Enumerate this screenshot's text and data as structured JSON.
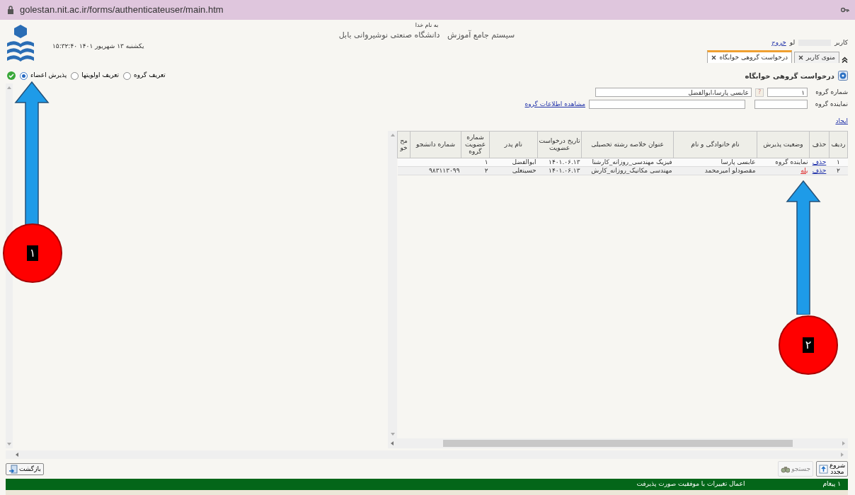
{
  "browser": {
    "url": "golestan.nit.ac.ir/forms/authenticateuser/main.htm"
  },
  "header": {
    "datetime": "۱۵:۳۲:۴۰ یکشنبه ۱۳ شهریور ۱۴۰۱",
    "blessing": "به نام خدا",
    "title": "سیستم جامع آموزش   دانشگاه صنعتی نوشیروانی بابل",
    "user_label": "کاربر",
    "user_name": "لو",
    "logout": "خروج"
  },
  "tabs": [
    {
      "label": "منوی کاربر",
      "selected": false
    },
    {
      "label": "درخواست گروهی خوابگاه",
      "selected": true
    }
  ],
  "modes": [
    {
      "label": "تعریف گروه",
      "selected": false
    },
    {
      "label": "تعریف اولویتها",
      "selected": false
    },
    {
      "label": "پذیرش اعضاء",
      "selected": true
    }
  ],
  "heading": "درخواست گروهی خوابگاه",
  "form": {
    "group_number_label": "شماره گروه",
    "group_number": "۱",
    "lookup_button": "?",
    "members": "عابسی  پارسا،ابوالفضل",
    "representative_label": "نماینده گروه",
    "view_group_link": "مشاهده اطلاعات گروه",
    "create_link": "ایجاد"
  },
  "table": {
    "columns": [
      "ردیف",
      "حذف",
      "وضعیت پذیرش",
      "نام خانوادگی و نام",
      "عنوان خلاصه رشته تحصیلی",
      "تاریخ درخواست عضویت",
      "نام پدر",
      "شماره عضویت گروه",
      "شماره دانشجو",
      "مح خو"
    ],
    "rows": [
      {
        "status_alert": false,
        "cells": [
          "۱",
          "حذف",
          "نماینده گروه",
          "عابسی پارسا",
          "فیزیک مهندسی_روزانه_کارشنا",
          "۱۴۰۱.۰۶.۱۳",
          "ابوالفضل",
          "۱",
          null,
          null
        ]
      },
      {
        "status_alert": true,
        "cells": [
          "۲",
          "حذف",
          "بله",
          "مقصودلو امیرمحمد",
          "مهندسی مکانیک_روزانه_کارش",
          "۱۴۰۱.۰۶.۱۳",
          "حسینعلی",
          "۲",
          "۹۸۳۱۱۳۰۹۹",
          null
        ]
      }
    ]
  },
  "buttons": [
    {
      "label": "شروع مجدد",
      "disabled": false
    },
    {
      "label": "جستجو",
      "disabled": true
    },
    {
      "label": "بازگشت",
      "disabled": false
    }
  ],
  "status_bar": {
    "count": "۱ پیغام",
    "message": "اعمال تغییرات با موفقیت صورت پذیرفت"
  },
  "annotations": [
    {
      "number": "۱"
    },
    {
      "number": "۲"
    }
  ]
}
